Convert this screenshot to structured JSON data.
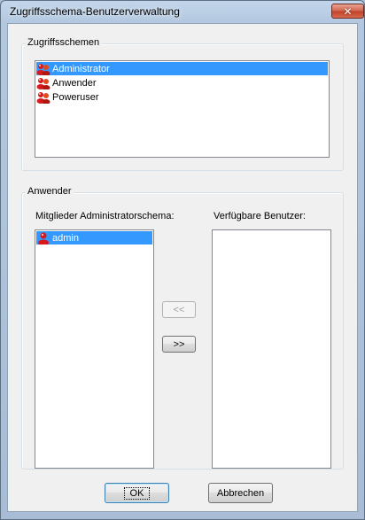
{
  "window": {
    "title": "Zugriffsschema-Benutzerverwaltung"
  },
  "schemes": {
    "legend": "Zugriffsschemen",
    "items": [
      {
        "label": "Administrator",
        "selected": true
      },
      {
        "label": "Anwender",
        "selected": false
      },
      {
        "label": "Poweruser",
        "selected": false
      }
    ]
  },
  "users": {
    "legend": "Anwender",
    "members_label": "Mitglieder Administratorschema:",
    "available_label": "Verfügbare Benutzer:",
    "members": [
      {
        "label": "admin",
        "selected": true
      }
    ],
    "available": [],
    "move_left_label": "<<",
    "move_right_label": ">>"
  },
  "buttons": {
    "ok_label": "OK",
    "cancel_label": "Abbrechen"
  },
  "colors": {
    "selection": "#3399ff",
    "icon": "#d7191c"
  }
}
